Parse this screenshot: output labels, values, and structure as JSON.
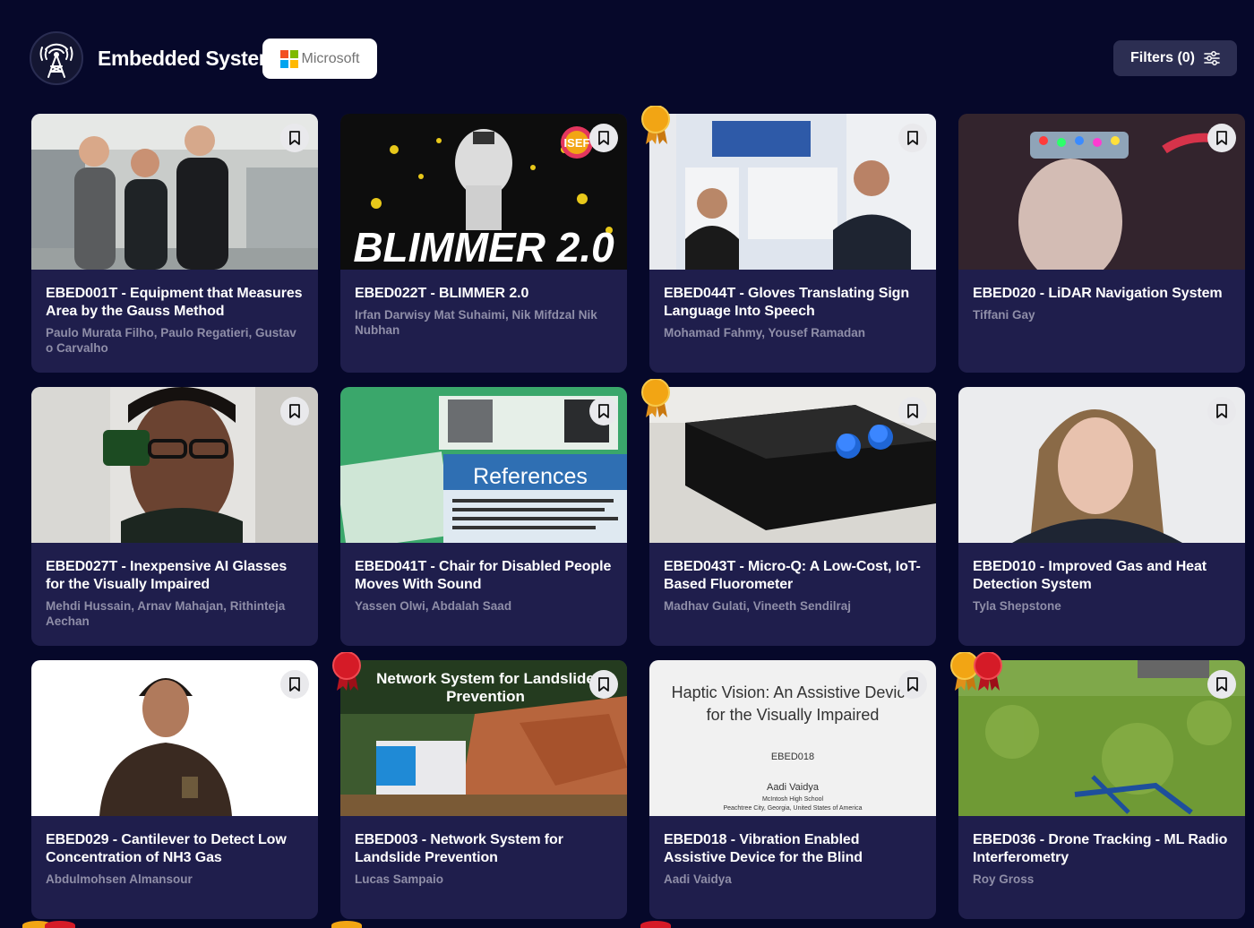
{
  "header": {
    "category_title": "Embedded Systems",
    "sponsor_name": "Microsoft",
    "filters_label": "Filters (0)"
  },
  "colors": {
    "background": "#06082a",
    "card": "#1f1e4c",
    "filters_button": "#2c2e52",
    "author_text": "#8f8ea8",
    "award_gold": "#f2a514",
    "award_red": "#d51b27"
  },
  "projects": [
    {
      "id": "EBED001T",
      "title": "EBED001T - Equipment that Measures Area by the Gauss Method",
      "authors": "Paulo Murata Filho, Paulo Regatieri, Gustav o Carvalho",
      "awards": []
    },
    {
      "id": "EBED022T",
      "title": "EBED022T - BLIMMER 2.0",
      "authors": "Irfan Darwisy Mat Suhaimi, Nik Mifdzal Nik Nubhan",
      "awards": [],
      "thumbnail_text": "BLIMMER 2.0",
      "thumbnail_badge": "ISEF"
    },
    {
      "id": "EBED044T",
      "title": "EBED044T - Gloves Translating Sign Language Into Speech",
      "authors": "Mohamad Fahmy, Yousef Ramadan",
      "awards": [
        "gold"
      ]
    },
    {
      "id": "EBED020",
      "title": "EBED020 - LiDAR Navigation System",
      "authors": "Tiffani Gay",
      "awards": []
    },
    {
      "id": "EBED027T",
      "title": "EBED027T - Inexpensive AI Glasses for the Visually Impaired",
      "authors": "Mehdi Hussain, Arnav Mahajan, Rithinteja Aechan",
      "awards": []
    },
    {
      "id": "EBED041T",
      "title": "EBED041T - Chair for Disabled People Moves With Sound",
      "authors": "Yassen Olwi, Abdalah Saad",
      "awards": [],
      "thumbnail_text": "References"
    },
    {
      "id": "EBED043T",
      "title": "EBED043T - Micro-Q: A Low-Cost, IoT-Based Fluorometer",
      "authors": "Madhav Gulati, Vineeth Sendilraj",
      "awards": [
        "gold"
      ]
    },
    {
      "id": "EBED010",
      "title": "EBED010 - Improved Gas and Heat Detection System",
      "authors": "Tyla Shepstone",
      "awards": []
    },
    {
      "id": "EBED029",
      "title": "EBED029 - Cantilever to Detect Low Concentration of NH3 Gas",
      "authors": "Abdulmohsen Almansour",
      "awards": []
    },
    {
      "id": "EBED003",
      "title": "EBED003 - Network System for Landslide Prevention",
      "authors": "Lucas Sampaio",
      "awards": [
        "red"
      ],
      "thumbnail_text": "Network System for Landslide Prevention"
    },
    {
      "id": "EBED018",
      "title": "EBED018 - Vibration Enabled Assistive Device for the Blind",
      "authors": "Aadi Vaidya",
      "awards": [],
      "thumbnail_text": "Haptic Vision: An Assistive Device for the Visually Impaired",
      "thumbnail_code": "EBED018",
      "thumbnail_author": "Aadi Vaidya",
      "thumbnail_school": "McIntosh High School",
      "thumbnail_location": "Peachtree City, Georgia, United States of America"
    },
    {
      "id": "EBED036",
      "title": "EBED036 - Drone Tracking - ML Radio Interferometry",
      "authors": "Roy Gross",
      "awards": [
        "gold",
        "red"
      ]
    }
  ]
}
